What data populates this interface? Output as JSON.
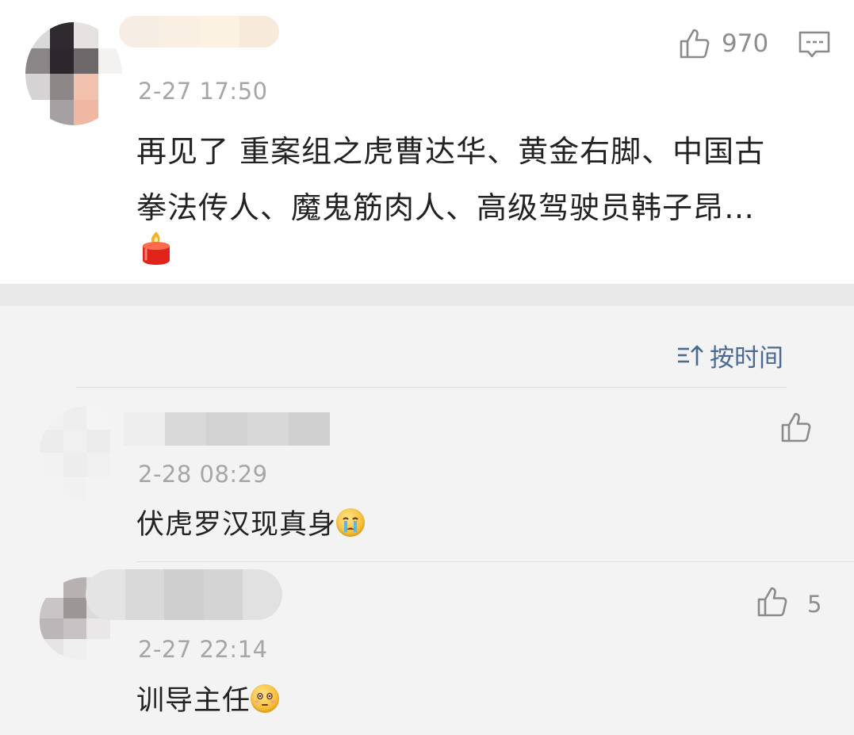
{
  "main_comment": {
    "time": "2-27 17:50",
    "like_count": "970",
    "text_line1": "再见了 重案组之虎曹达华、黄金右脚、中国古",
    "text_line2": "拳法传人、魔鬼筋肉人、高级驾驶员韩子昂…",
    "emoji": "candle-emoji"
  },
  "sort": {
    "label": "按时间",
    "icon": "sort-icon",
    "color": "#4a6a92"
  },
  "replies": [
    {
      "time": "2-28 08:29",
      "text": "伏虎罗汉现真身",
      "emoji": "crying-emoji",
      "like_count": ""
    },
    {
      "time": "2-27 22:14",
      "text": "训导主任",
      "emoji": "flushed-emoji",
      "like_count": "5"
    }
  ],
  "icons": {
    "like": "thumbs-up-icon",
    "reply": "comment-icon"
  }
}
